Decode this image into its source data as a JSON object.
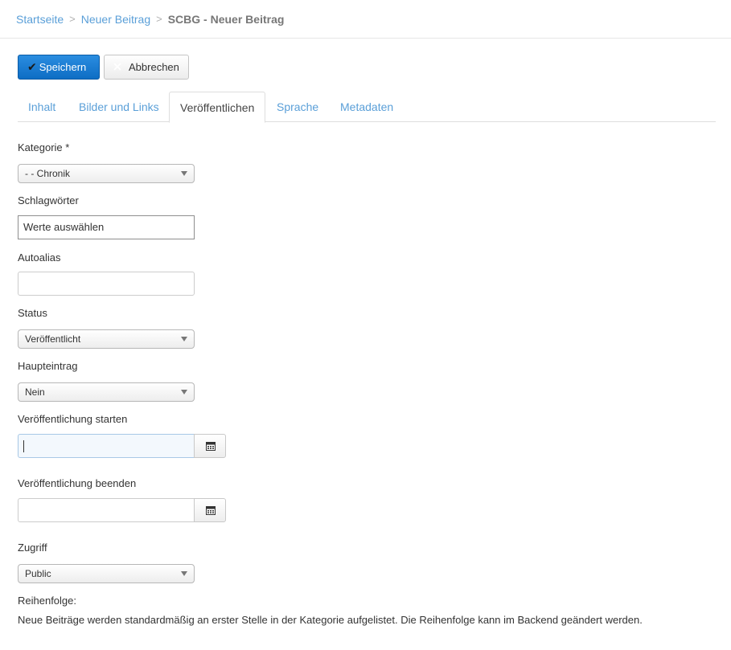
{
  "breadcrumb": {
    "home": "Startseite",
    "parent": "Neuer Beitrag",
    "current": "SCBG - Neuer Beitrag"
  },
  "toolbar": {
    "save_label": "Speichern",
    "cancel_label": "Abbrechen"
  },
  "tabs": [
    {
      "label": "Inhalt"
    },
    {
      "label": "Bilder und Links"
    },
    {
      "label": "Veröffentlichen"
    },
    {
      "label": "Sprache"
    },
    {
      "label": "Metadaten"
    }
  ],
  "form": {
    "kategorie": {
      "label": "Kategorie *",
      "value": "- - Chronik"
    },
    "schlagwoerter": {
      "label": "Schlagwörter",
      "placeholder": "Werte auswählen"
    },
    "autoalias": {
      "label": "Autoalias",
      "value": ""
    },
    "status": {
      "label": "Status",
      "value": "Veröffentlicht"
    },
    "haupteintrag": {
      "label": "Haupteintrag",
      "value": "Nein"
    },
    "publish_up": {
      "label": "Veröffentlichung starten",
      "value": ""
    },
    "publish_down": {
      "label": "Veröffentlichung beenden",
      "value": ""
    },
    "zugriff": {
      "label": "Zugriff",
      "value": "Public"
    },
    "reihenfolge": {
      "label": "Reihenfolge:",
      "text": "Neue Beiträge werden standardmäßig an erster Stelle in der Kategorie aufgelistet. Die Reihenfolge kann im Backend geändert werden."
    }
  },
  "icons": {
    "save": "check-icon",
    "cancel": "close-icon",
    "calendar": "calendar-icon"
  },
  "colors": {
    "link": "#5a9fd8",
    "primary_button": "#1473cf"
  }
}
